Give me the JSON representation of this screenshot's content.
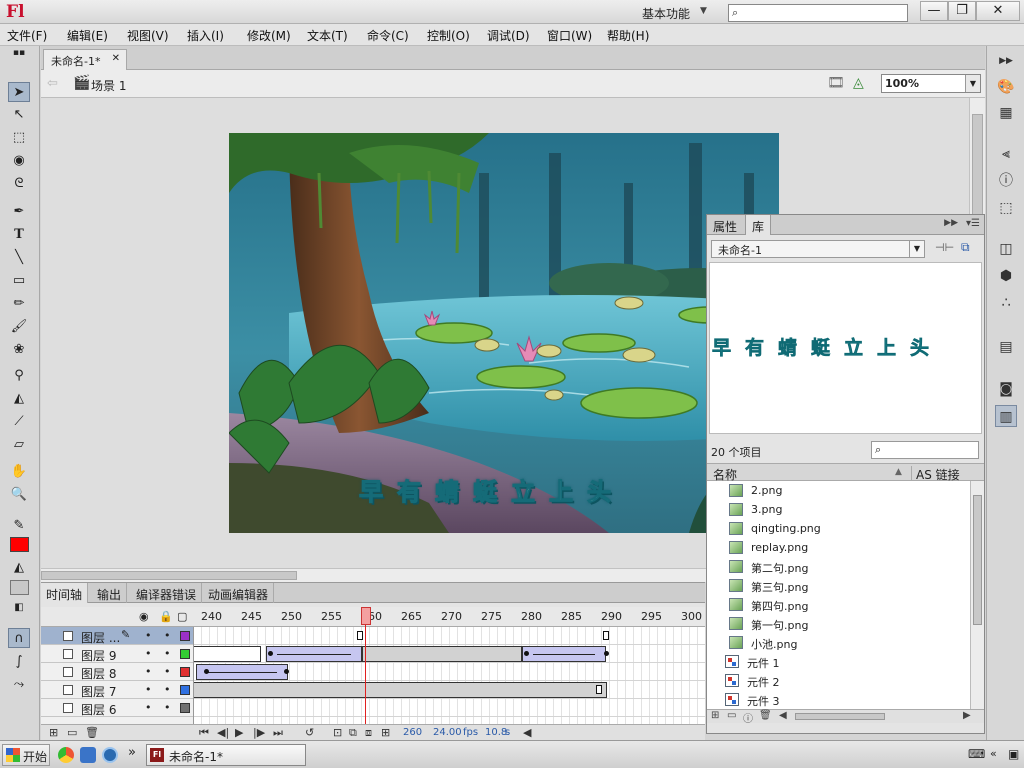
{
  "app": {
    "logo": "Fl",
    "workspace": "基本功能",
    "window_controls": {
      "minimize": "—",
      "restore": "❐",
      "close": "✕"
    }
  },
  "menu": [
    "文件(F)",
    "编辑(E)",
    "视图(V)",
    "插入(I)",
    "修改(M)",
    "文本(T)",
    "命令(C)",
    "控制(O)",
    "调试(D)",
    "窗口(W)",
    "帮助(H)"
  ],
  "document": {
    "tab_label": "未命名-1*",
    "scene_label": "场景 1",
    "zoom": "100%",
    "stage_caption": "早有蜻蜓立上头"
  },
  "tools": [
    "selection-tool",
    "subselection-tool",
    "free-transform-tool",
    "3d-rotation-tool",
    "lasso-tool",
    "pen-tool",
    "text-tool",
    "line-tool",
    "rectangle-tool",
    "pencil-tool",
    "brush-tool",
    "deco-tool",
    "bone-tool",
    "paint-bucket-tool",
    "eyedropper-tool",
    "eraser-tool",
    "hand-tool",
    "zoom-tool",
    "stroke-color",
    "fill-color",
    "swap-colors",
    "snap-to-objects",
    "smooth",
    "straighten"
  ],
  "colors": {
    "stroke": "#000000",
    "fill": "#ff0000",
    "selected_layer": "#9fb2ce",
    "tween": "#c6c6f0",
    "playhead": "#e02020"
  },
  "library": {
    "tabs": [
      "属性",
      "库"
    ],
    "active_tab": "库",
    "document_select": "未命名-1",
    "preview_text": "早有蜻蜓立上头",
    "item_count": "20 个项目",
    "columns": {
      "name": "名称",
      "linkage": "AS 链接"
    },
    "items": [
      {
        "label": "2.png",
        "kind": "bitmap"
      },
      {
        "label": "3.png",
        "kind": "bitmap"
      },
      {
        "label": "qingting.png",
        "kind": "bitmap"
      },
      {
        "label": "replay.png",
        "kind": "bitmap"
      },
      {
        "label": "第二句.png",
        "kind": "bitmap"
      },
      {
        "label": "第三句.png",
        "kind": "bitmap"
      },
      {
        "label": "第四句.png",
        "kind": "bitmap"
      },
      {
        "label": "第一句.png",
        "kind": "bitmap"
      },
      {
        "label": "小池.png",
        "kind": "bitmap"
      },
      {
        "label": "元件 1",
        "kind": "symbol"
      },
      {
        "label": "元件 2",
        "kind": "symbol"
      },
      {
        "label": "元件 3",
        "kind": "symbol"
      }
    ]
  },
  "timeline": {
    "tabs": [
      "时间轴",
      "输出",
      "编译器错误",
      "动画编辑器"
    ],
    "ruler": [
      "240",
      "245",
      "250",
      "255",
      "260",
      "265",
      "270",
      "275",
      "280",
      "285",
      "290",
      "295",
      "300"
    ],
    "current_frame": "260",
    "fps": "24.00",
    "fps_unit": "fps",
    "elapsed": "10.8",
    "elapsed_unit": "s",
    "layers": [
      {
        "name": "图层 ...",
        "selected": true,
        "color": "#9b30c8"
      },
      {
        "name": "图层 9",
        "selected": false,
        "color": "#33cc33"
      },
      {
        "name": "图层 8",
        "selected": false,
        "color": "#e03030"
      },
      {
        "name": "图层 7",
        "selected": false,
        "color": "#3070e0"
      },
      {
        "name": "图层 6",
        "selected": false,
        "color": "#707070"
      }
    ]
  },
  "taskbar": {
    "start_label": "开始",
    "task_label": "未命名-1*",
    "chevron": "»",
    "tray_kbd": "⌨",
    "tray_arrow": "«",
    "tray_net": "▣"
  }
}
